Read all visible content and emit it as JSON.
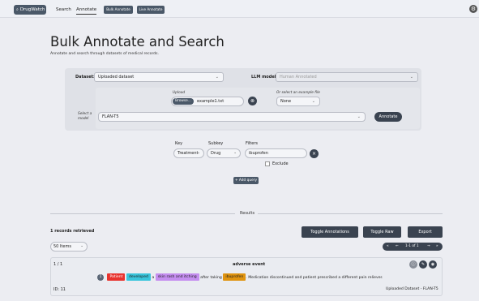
{
  "nav": {
    "brand": "DrugWatch",
    "links": [
      "Search",
      "Annotate"
    ],
    "buttons": [
      "Bulk Annotate",
      "Live Annotate"
    ]
  },
  "page": {
    "title": "Bulk Annotate and Search",
    "subtitle": "Annotate and search through datasets of medical records."
  },
  "form": {
    "dataset_label": "Dataset:",
    "dataset_value": "Uploaded dataset",
    "llm_label": "LLM model:",
    "llm_value": "Human Annotated",
    "upload_label": "Upload",
    "browse_label": "Browse...",
    "file_name": "example1.txt",
    "example_label": "Or select an example file",
    "example_value": "None",
    "model_label": "Select a model",
    "model_value": "FLAN-T5",
    "annotate_label": "Annotate"
  },
  "query": {
    "key_label": "Key",
    "key_value": "Treatment",
    "subkey_label": "Subkey",
    "subkey_value": "Drug",
    "filters_label": "Filters",
    "filter_value": "ibuprofen",
    "exclude_label": "Exclude",
    "add_query_label": "+ Add query"
  },
  "results": {
    "section_label": "Results",
    "retrieved_text": "1 records retrieved",
    "toggle_annotations": "Toggle Annotations",
    "toggle_raw": "Toggle Raw",
    "export": "Export",
    "items_select": "50 Items",
    "pager": {
      "first": "«",
      "prev": "←",
      "page_text": "1-1 of 1",
      "next": "→",
      "last": "»"
    }
  },
  "record": {
    "count": "1 / 1",
    "title": "adverse event",
    "circle": "1",
    "tags": {
      "patient": "Patient",
      "developed": "developed",
      "skin": "skin rash and itching",
      "ibuprofen": "ibuprofen"
    },
    "text_a": "a",
    "text_b": "after taking",
    "text_c": ". Medication discontinued and patient prescribed a different pain reliever.",
    "id": "ID: 11",
    "source": "Uploaded Dataset - FLAN-T5"
  },
  "colors": {
    "nav_button": "#4a5868",
    "dark_button": "#3a4350",
    "tag_patient": "#e8332e",
    "tag_developed": "#39c5dc",
    "tag_skin": "#c58ef0",
    "tag_ibuprofen": "#e09410"
  }
}
